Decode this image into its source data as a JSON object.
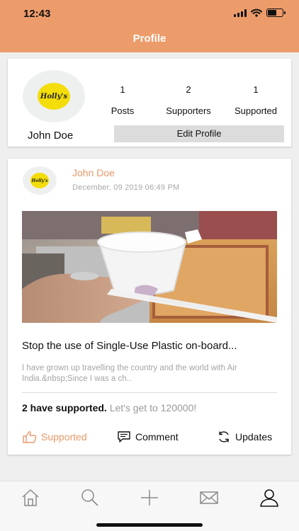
{
  "status_bar": {
    "time": "12:43"
  },
  "header": {
    "title": "Profile"
  },
  "profile": {
    "name": "John Doe",
    "logo_text": "Holly's",
    "stats": [
      {
        "value": "1",
        "label": "Posts"
      },
      {
        "value": "2",
        "label": "Supporters"
      },
      {
        "value": "1",
        "label": "Supported"
      }
    ],
    "edit_label": "Edit Profile"
  },
  "post": {
    "author": "John Doe",
    "date": "December, 09 2019  06:49 PM",
    "title": "Stop the use of Single-Use Plastic on-board...",
    "excerpt": "I have grown up travelling the country and the world with Air India.&nbsp;Since I was a ch..",
    "supported_count": "2 have supported.",
    "goal_text": " Let's get to 120000!",
    "actions": {
      "supported": "Supported",
      "comment": "Comment",
      "updates": "Updates"
    }
  },
  "tabbar": {
    "items": [
      "home-icon",
      "search-icon",
      "add-icon",
      "mail-icon",
      "profile-icon"
    ],
    "active": "profile-icon"
  },
  "colors": {
    "accent": "#ec9c6b",
    "author": "#e89968",
    "logo_yellow": "#f3dd0a"
  }
}
